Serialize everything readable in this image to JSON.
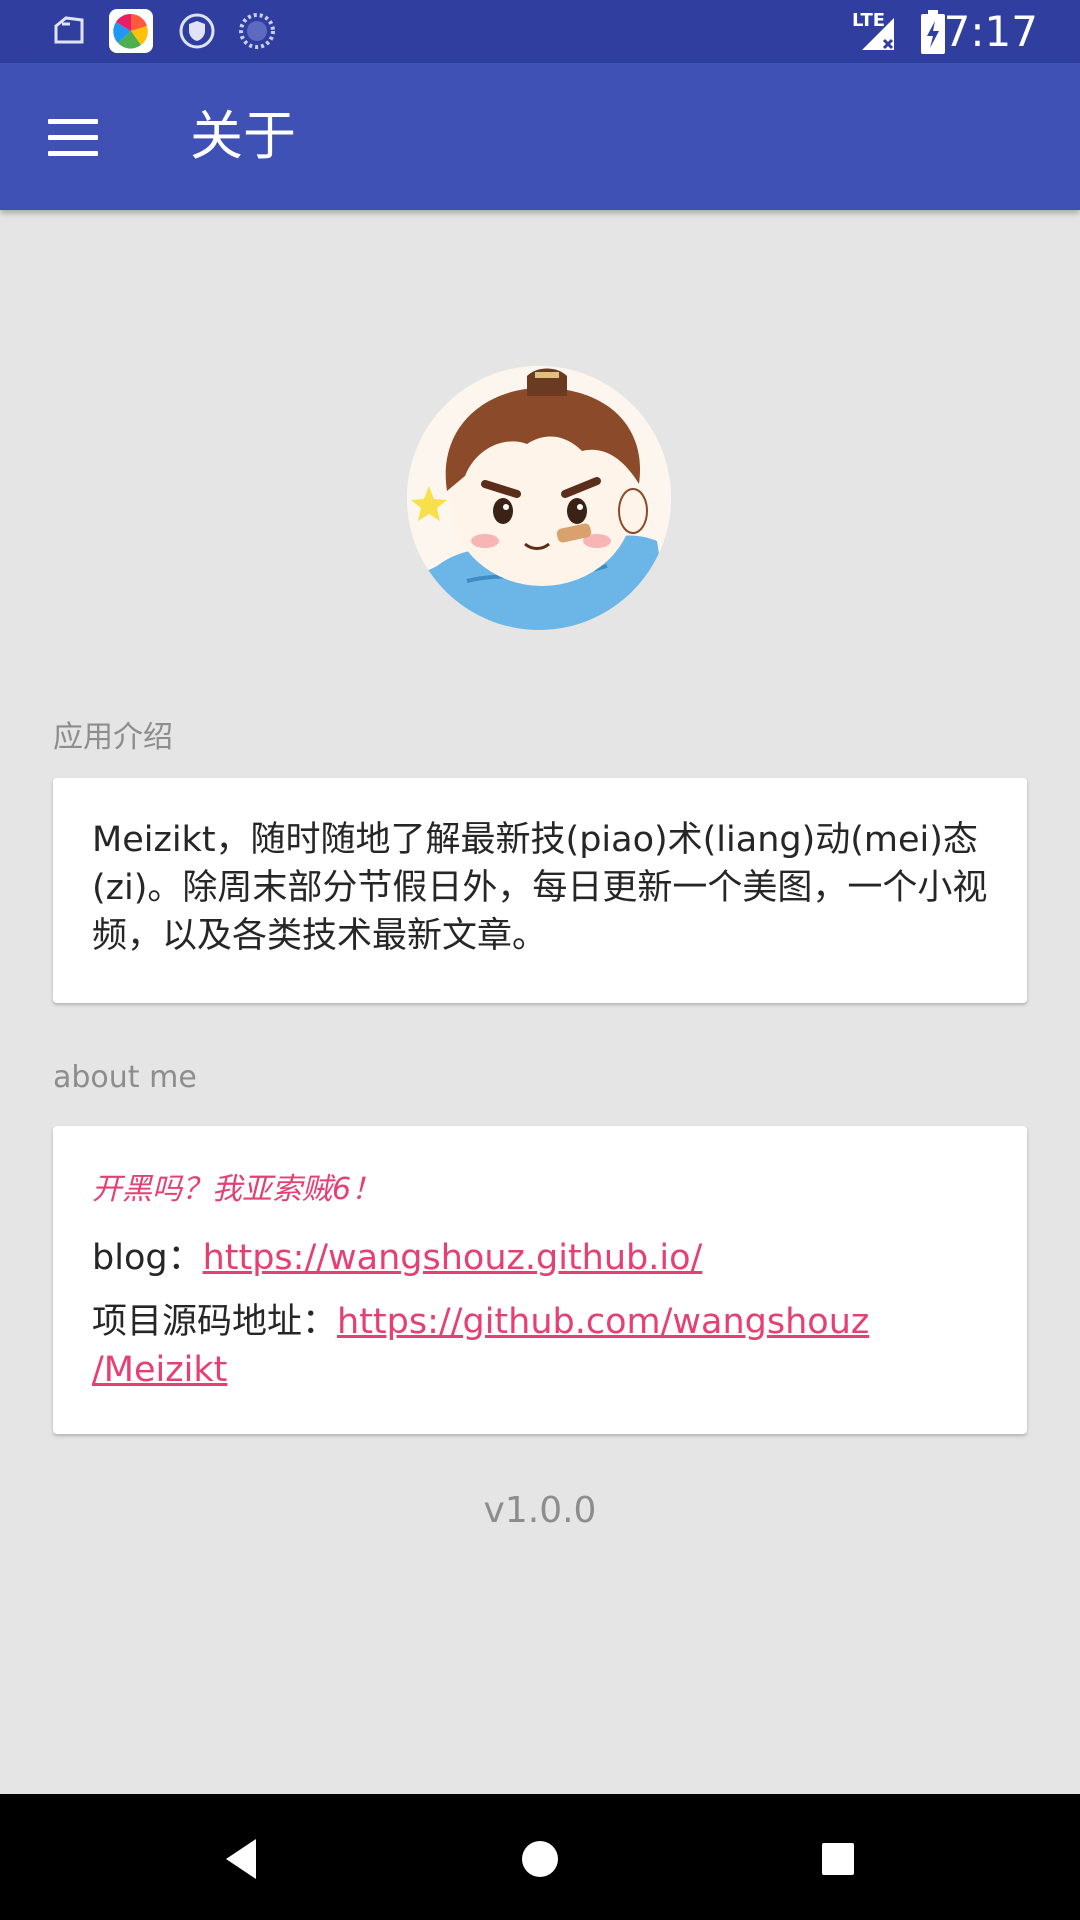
{
  "status_bar": {
    "time": "7:17",
    "network_label": "LTE",
    "icons": [
      "notification-app-icon",
      "store-app-icon",
      "vpn-shield-icon",
      "sync-progress-icon",
      "cellular-signal-icon",
      "battery-charging-icon"
    ]
  },
  "app_bar": {
    "title": "关于"
  },
  "intro": {
    "label": "应用介绍",
    "text": "Meizikt，随时随地了解最新技(piao)术(liang)动(mei)态(zi)。除周末部分节假日外，每日更新一个美图，一个小视频，以及各类技术最新文章。"
  },
  "about_me": {
    "label": "about me",
    "quote": "开黑吗？我亚索贼6！",
    "blog_label": "blog：",
    "blog_url": "https://wangshouz.github.io/",
    "source_label": "项目源码地址：",
    "source_url_line1": "https://github.com/wangshouz",
    "source_url_line2": "/Meizikt"
  },
  "version": "v1.0.0",
  "nav_bar": {
    "buttons": [
      "back",
      "home",
      "recents"
    ]
  },
  "colors": {
    "status_bar": "#303f9f",
    "app_bar": "#3f51b5",
    "accent": "#e63f73",
    "background": "#e5e5e5"
  }
}
